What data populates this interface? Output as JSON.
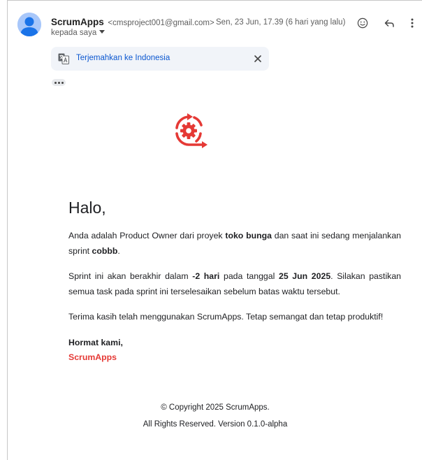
{
  "header": {
    "sender_name": "ScrumApps",
    "sender_email": "<cmsproject001@gmail.com>",
    "recipient_label": "kepada saya",
    "date": "Sen, 23 Jun, 17.39 (6 hari yang lalu)"
  },
  "icons": {
    "avatar": "person-avatar-icon",
    "emoji": "emoji-smile-icon",
    "reply": "reply-arrow-icon",
    "more": "more-vertical-icon",
    "translate": "translate-icon",
    "close": "close-icon",
    "ellipsis": "show-trimmed-content-icon",
    "logo": "scrum-cycle-gear-logo"
  },
  "translate_bar": {
    "link": "Terjemahkan ke Indonesia"
  },
  "body": {
    "greeting": "Halo,",
    "p1_before": "Anda adalah Product Owner dari proyek ",
    "project_name": "toko bunga",
    "p1_mid": " dan saat ini sedang menjalankan sprint ",
    "sprint_name": "cobbb",
    "p1_end": ".",
    "p2_before": "Sprint ini akan berakhir dalam ",
    "remaining": "-2 hari",
    "p2_mid": " pada tanggal ",
    "end_date": "25 Jun 2025",
    "p2_end": ". Silakan pastikan semua task pada sprint ini terselesaikan sebelum batas waktu tersebut.",
    "p3": "Terima kasih telah menggunakan ScrumApps. Tetap semangat dan tetap produktif!",
    "regards": "Hormat kami,",
    "brand": "ScrumApps"
  },
  "footer": {
    "copyright": "© Copyright 2025 ScrumApps.",
    "rights": "All Rights Reserved. Version 0.1.0-alpha"
  },
  "colors": {
    "brand_red": "#e53935",
    "link_blue": "#0b57d0",
    "avatar_bg": "#a8c7fa",
    "avatar_fg": "#1a73e8"
  }
}
